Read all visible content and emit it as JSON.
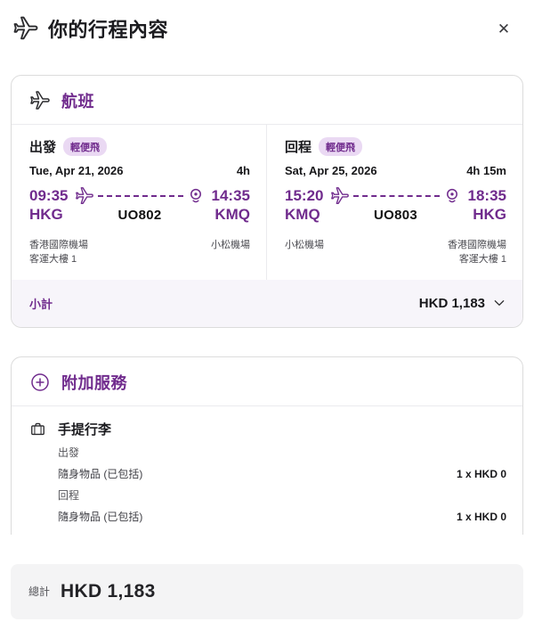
{
  "header": {
    "title": "你的行程內容",
    "close_glyph": "✕"
  },
  "flight_card": {
    "title": "航班",
    "segments": [
      {
        "direction_label": "出發",
        "fare_badge": "輕便飛",
        "date": "Tue, Apr 21, 2026",
        "duration": "4h",
        "dep_time": "09:35",
        "dep_code": "HKG",
        "arr_time": "14:35",
        "arr_code": "KMQ",
        "flight_no": "UO802",
        "dep_airport_line1": "香港國際機場",
        "dep_airport_line2": "客運大樓 1",
        "arr_airport_line1": "小松機場",
        "arr_airport_line2": ""
      },
      {
        "direction_label": "回程",
        "fare_badge": "輕便飛",
        "date": "Sat, Apr 25, 2026",
        "duration": "4h 15m",
        "dep_time": "15:20",
        "dep_code": "KMQ",
        "arr_time": "18:35",
        "arr_code": "HKG",
        "flight_no": "UO803",
        "dep_airport_line1": "小松機場",
        "dep_airport_line2": "",
        "arr_airport_line1": "香港國際機場",
        "arr_airport_line2": "客運大樓 1"
      }
    ],
    "subtotal_label": "小計",
    "subtotal_value": "HKD 1,183"
  },
  "addons_card": {
    "title": "附加服務",
    "baggage": {
      "title": "手提行李",
      "section1": "出發",
      "item1_label": "隨身物品 (已包括)",
      "item1_value": "1 x HKD 0",
      "section2": "回程",
      "item2_label": "隨身物品 (已包括)",
      "item2_value": "1 x HKD 0"
    }
  },
  "footer": {
    "total_label": "總計",
    "total_value": "HKD 1,183"
  },
  "colors": {
    "accent": "#702b8d",
    "badge_bg": "#ead9f3",
    "subtotal_bg": "#f7f5fa",
    "total_bg": "#f4f4f5"
  }
}
